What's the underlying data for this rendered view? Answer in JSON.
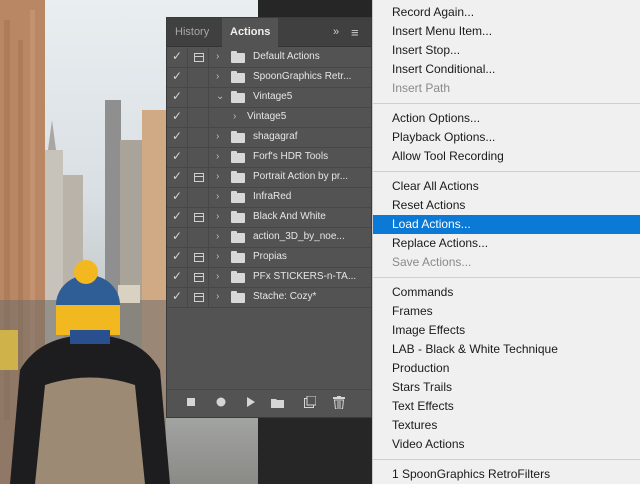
{
  "colors": {
    "panel_bg": "#535353",
    "menu_bg": "#f0f0f0",
    "menu_highlight": "#0b79d6",
    "menu_disabled": "#8a8a8a"
  },
  "panel": {
    "tabs": [
      {
        "label": "History",
        "active": false
      },
      {
        "label": "Actions",
        "active": true
      }
    ],
    "collapse_icon": "»",
    "menu_icon": "≡",
    "rows": [
      {
        "label": "Default Actions",
        "checked": true,
        "dialog": true,
        "toggle": "›",
        "folder": true,
        "child": false
      },
      {
        "label": "SpoonGraphics Retr...",
        "checked": true,
        "dialog": false,
        "toggle": "›",
        "folder": true,
        "child": false
      },
      {
        "label": "Vintage5",
        "checked": true,
        "dialog": false,
        "toggle": "⌄",
        "folder": true,
        "child": false
      },
      {
        "label": "Vintage5",
        "checked": true,
        "dialog": false,
        "toggle": "›",
        "folder": false,
        "child": true
      },
      {
        "label": "shagagraf",
        "checked": true,
        "dialog": false,
        "toggle": "›",
        "folder": true,
        "child": false
      },
      {
        "label": "Forf's HDR Tools",
        "checked": true,
        "dialog": false,
        "toggle": "›",
        "folder": true,
        "child": false
      },
      {
        "label": "Portrait Action by pr...",
        "checked": true,
        "dialog": true,
        "toggle": "›",
        "folder": true,
        "child": false
      },
      {
        "label": "InfraRed",
        "checked": true,
        "dialog": false,
        "toggle": "›",
        "folder": true,
        "child": false
      },
      {
        "label": "Black And White",
        "checked": true,
        "dialog": true,
        "toggle": "›",
        "folder": true,
        "child": false
      },
      {
        "label": "action_3D_by_noe...",
        "checked": true,
        "dialog": false,
        "toggle": "›",
        "folder": true,
        "child": false
      },
      {
        "label": "Propias",
        "checked": true,
        "dialog": true,
        "toggle": "›",
        "folder": true,
        "child": false
      },
      {
        "label": "PFx STICKERS-n-TA...",
        "checked": true,
        "dialog": true,
        "toggle": "›",
        "folder": true,
        "child": false
      },
      {
        "label": "Stache: Cozy*",
        "checked": true,
        "dialog": true,
        "toggle": "›",
        "folder": true,
        "child": false
      }
    ],
    "footer_icons": [
      "stop-icon",
      "record-icon",
      "play-icon",
      "new-set-icon",
      "new-action-icon",
      "delete-icon"
    ]
  },
  "menu": {
    "groups": [
      [
        {
          "label": "Record Again...",
          "disabled": false
        },
        {
          "label": "Insert Menu Item...",
          "disabled": false
        },
        {
          "label": "Insert Stop...",
          "disabled": false
        },
        {
          "label": "Insert Conditional...",
          "disabled": false
        },
        {
          "label": "Insert Path",
          "disabled": true
        }
      ],
      [
        {
          "label": "Action Options...",
          "disabled": false
        },
        {
          "label": "Playback Options...",
          "disabled": false
        },
        {
          "label": "Allow Tool Recording",
          "disabled": false
        }
      ],
      [
        {
          "label": "Clear All Actions",
          "disabled": false
        },
        {
          "label": "Reset Actions",
          "disabled": false
        },
        {
          "label": "Load Actions...",
          "disabled": false,
          "highlighted": true
        },
        {
          "label": "Replace Actions...",
          "disabled": false
        },
        {
          "label": "Save Actions...",
          "disabled": true
        }
      ],
      [
        {
          "label": "Commands",
          "disabled": false
        },
        {
          "label": "Frames",
          "disabled": false
        },
        {
          "label": "Image Effects",
          "disabled": false
        },
        {
          "label": "LAB - Black & White Technique",
          "disabled": false
        },
        {
          "label": "Production",
          "disabled": false
        },
        {
          "label": "Stars Trails",
          "disabled": false
        },
        {
          "label": "Text Effects",
          "disabled": false
        },
        {
          "label": "Textures",
          "disabled": false
        },
        {
          "label": "Video Actions",
          "disabled": false
        }
      ],
      [
        {
          "label": "1 SpoonGraphics RetroFilters",
          "disabled": false
        }
      ]
    ]
  }
}
